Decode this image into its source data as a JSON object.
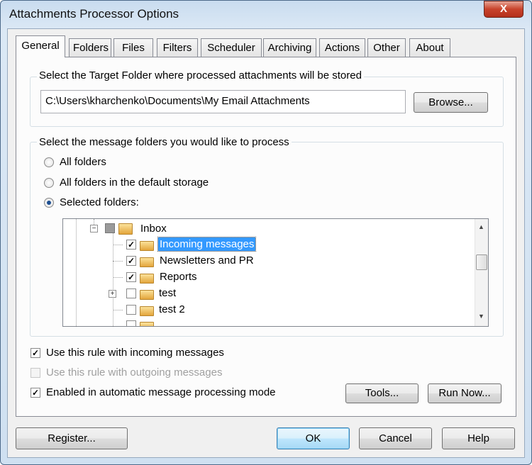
{
  "window": {
    "title": "Attachments Processor Options",
    "close": "X"
  },
  "tabs": [
    {
      "label": "General"
    },
    {
      "label": "Folders"
    },
    {
      "label": "Files"
    },
    {
      "label": "Filters"
    },
    {
      "label": "Scheduler"
    },
    {
      "label": "Archiving"
    },
    {
      "label": "Actions"
    },
    {
      "label": "Other"
    },
    {
      "label": "About"
    }
  ],
  "target": {
    "label": "Select the Target Folder where processed attachments will be stored",
    "path": "C:\\Users\\kharchenko\\Documents\\My Email Attachments",
    "browse": "Browse..."
  },
  "folders": {
    "label": "Select the message folders you would like to process",
    "options": [
      {
        "label": "All folders",
        "checked": false
      },
      {
        "label": "All folders in the default storage",
        "checked": false
      },
      {
        "label": "Selected folders:",
        "checked": true
      }
    ],
    "tree": [
      {
        "label": "Inbox",
        "checked": "partial",
        "expander": "-"
      },
      {
        "label": "Incoming messages",
        "checked": true,
        "selected": true
      },
      {
        "label": "Newsletters and PR",
        "checked": true
      },
      {
        "label": "Reports",
        "checked": true
      },
      {
        "label": "test",
        "checked": false,
        "expander": "+"
      },
      {
        "label": "test 2",
        "checked": false
      }
    ]
  },
  "options": [
    {
      "label": "Use this rule with incoming messages",
      "checked": true,
      "enabled": true
    },
    {
      "label": "Use this rule with outgoing messages",
      "checked": false,
      "enabled": false
    },
    {
      "label": "Enabled in automatic message processing mode",
      "checked": true,
      "enabled": true
    }
  ],
  "buttons": {
    "tools": "Tools...",
    "run_now": "Run Now...",
    "register": "Register...",
    "ok": "OK",
    "cancel": "Cancel",
    "help": "Help"
  }
}
